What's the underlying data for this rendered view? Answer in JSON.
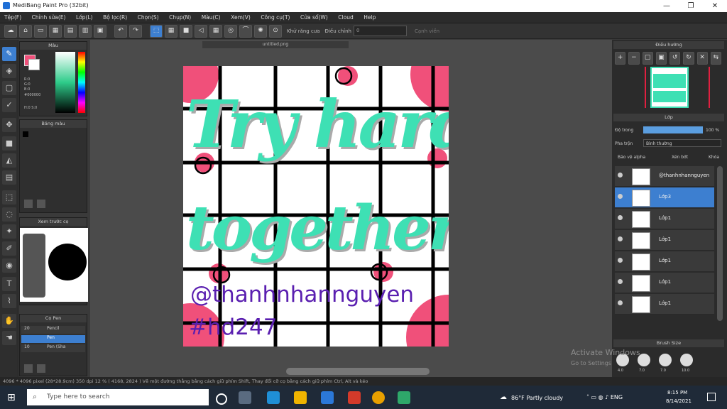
{
  "window": {
    "title": "MediBang Paint Pro (32bit)",
    "minimize": "—",
    "maximize": "❐",
    "close": "✕"
  },
  "menu": [
    "Tệp(F)",
    "Chỉnh sửa(E)",
    "Lớp(L)",
    "Bộ lọc(R)",
    "Chọn(S)",
    "Chụp(N)",
    "Màu(C)",
    "Xem(V)",
    "Công cụ(T)",
    "Cửa sổ(W)",
    "Cloud",
    "Help"
  ],
  "toolbar": {
    "antialias_label": "Khử răng cưa",
    "correction_label": "Điều chỉnh",
    "correction_value": "0",
    "brush_label": "Cạnh viền"
  },
  "panels": {
    "color": "Màu",
    "palette": "Bảng màu",
    "navigator": "Xem trước cọ",
    "brush": "Cọ Pen",
    "navigator_title": "Điều hướng",
    "layer": "Lớp",
    "brush_size": "Brush Size"
  },
  "color_values": {
    "r": "R:0",
    "g": "G:0",
    "b": "B:0",
    "hex": "#000000",
    "hsv": "H:0 S:0"
  },
  "brush_list": [
    {
      "size": "20",
      "name": "Pencil"
    },
    {
      "size": "",
      "name": "Pen"
    },
    {
      "size": "10",
      "name": "Pen (Sha"
    }
  ],
  "doc": {
    "tab": "untitled.png",
    "line1": "Try hard",
    "line2": "together",
    "handle": "@thanhnhannguyen",
    "tag": "#hd247"
  },
  "layer_panel": {
    "opacity_label": "Độ trong",
    "opacity_value": "100 %",
    "blend_label": "Pha trộn",
    "blend_value": "Bình thường",
    "protect_alpha": "Bảo vệ alpha",
    "clip": "Xén bớt",
    "lock": "Khóa"
  },
  "layers": [
    {
      "name": "@thanhnhannguyen",
      "selected": false
    },
    {
      "name": "Lớp3",
      "selected": true
    },
    {
      "name": "Lớp1",
      "selected": false
    },
    {
      "name": "Lớp1",
      "selected": false
    },
    {
      "name": "Lớp1",
      "selected": false
    },
    {
      "name": "Lớp1",
      "selected": false
    },
    {
      "name": "Lớp1",
      "selected": false
    }
  ],
  "brush_sizes": [
    "4.0",
    "7.0",
    "7.0",
    "10.0"
  ],
  "status": "4096 * 4096 pixel  (28*28.9cm)  350 dpi  12 %  ( 4168, 2824 )  Vẽ một đường thẳng bằng cách giữ phím Shift, Thay đổi cỡ cọ bằng cách giữ phím Ctrl, Alt và kéo",
  "watermark": {
    "line1": "Activate Windows",
    "line2": "Go to Settings"
  },
  "taskbar": {
    "search_placeholder": "Type here to search",
    "weather": "86°F  Partly cloudy",
    "time": "8:15 PM",
    "date": "8/14/2021"
  },
  "colors": {
    "accent": "#3d7fd0",
    "teal": "#3ee0b4",
    "pink": "#f0507a",
    "purple": "#5a1fb0"
  }
}
